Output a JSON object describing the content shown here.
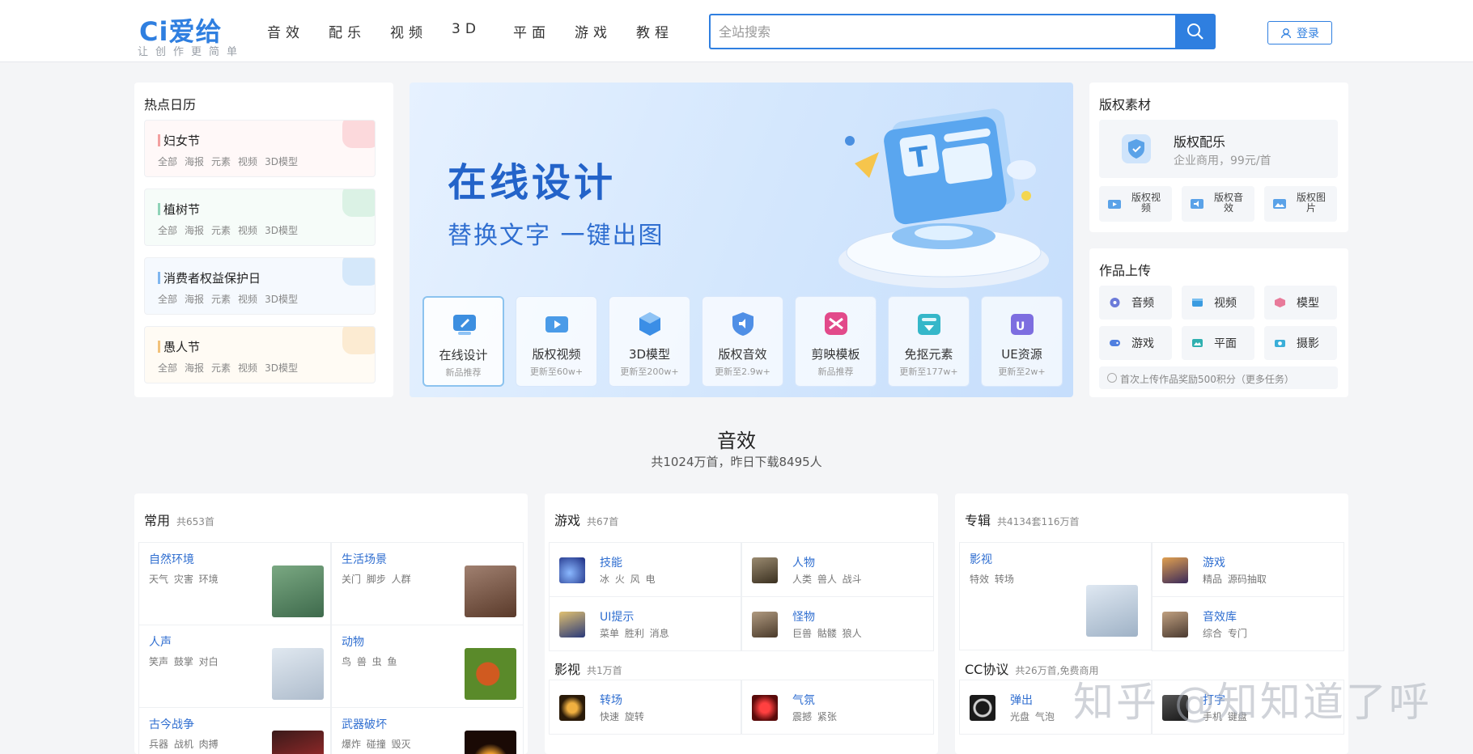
{
  "brand": {
    "logo": "Ci爱给",
    "slogan": "让创作更简单",
    "accent": "#2f7fe0"
  },
  "nav": [
    "音效",
    "配乐",
    "视频",
    "3D",
    "平面",
    "游戏",
    "教程"
  ],
  "search": {
    "placeholder": "全站搜索",
    "icon": "search-icon"
  },
  "login": {
    "label": "登录",
    "icon": "user-icon"
  },
  "hot_calendar": {
    "title": "热点日历",
    "items": [
      {
        "name": "妇女节",
        "color": "#f3a0a0",
        "tags": [
          "全部",
          "海报",
          "元素",
          "视频",
          "3D模型"
        ]
      },
      {
        "name": "植树节",
        "color": "#8fd3b8",
        "tags": [
          "全部",
          "海报",
          "元素",
          "视频",
          "3D模型"
        ]
      },
      {
        "name": "消费者权益保护日",
        "color": "#7fb6ef",
        "tags": [
          "全部",
          "海报",
          "元素",
          "视频",
          "3D模型"
        ]
      },
      {
        "name": "愚人节",
        "color": "#f2c27a",
        "tags": [
          "全部",
          "海报",
          "元素",
          "视频",
          "3D模型"
        ]
      }
    ]
  },
  "banner": {
    "title": "在线设计",
    "subtitle": "替换文字 一键出图",
    "tiles": [
      {
        "name": "在线设计",
        "sub": "新品推荐",
        "color": "#3d8fe0"
      },
      {
        "name": "版权视频",
        "sub": "更新至60w+",
        "color": "#4a9be8"
      },
      {
        "name": "3D模型",
        "sub": "更新至200w+",
        "color": "#3b8ee6"
      },
      {
        "name": "版权音效",
        "sub": "更新至2.9w+",
        "color": "#4f8fe6"
      },
      {
        "name": "剪映模板",
        "sub": "新品推荐",
        "color": "#e24a8a"
      },
      {
        "name": "免抠元素",
        "sub": "更新至177w+",
        "color": "#35b7c9"
      },
      {
        "name": "UE资源",
        "sub": "更新至2w+",
        "color": "#7d6ee0"
      }
    ]
  },
  "rights": {
    "title": "版权素材",
    "main": {
      "title": "版权配乐",
      "sub": "企业商用，99元/首"
    },
    "minis": [
      {
        "label": "版权视频",
        "color": "#5aa2e8"
      },
      {
        "label": "版权音效",
        "color": "#5aa2e8"
      },
      {
        "label": "版权图片",
        "color": "#5aa2e8"
      }
    ]
  },
  "upload": {
    "title": "作品上传",
    "buttons": [
      {
        "label": "音频",
        "color": "#6c7bd9"
      },
      {
        "label": "视频",
        "color": "#3a9be0"
      },
      {
        "label": "模型",
        "color": "#e87a9a"
      },
      {
        "label": "游戏",
        "color": "#4f7fe0"
      },
      {
        "label": "平面",
        "color": "#2fb0b0"
      },
      {
        "label": "摄影",
        "color": "#3aaed8"
      }
    ],
    "note": "首次上传作品奖励500积分（更多任务）"
  },
  "section": {
    "title": "音效",
    "sub": "共1024万首，昨日下载8495人"
  },
  "common": {
    "title": "常用",
    "count": "共653首",
    "cells": [
      {
        "title": "自然环境",
        "sub": "天气 灾害 环境",
        "img": "#4f7a5a"
      },
      {
        "title": "生活场景",
        "sub": "关门 脚步 人群",
        "img": "#7a5a4a"
      },
      {
        "title": "人声",
        "sub": "笑声 鼓掌 对白",
        "img": "#c9d6e3"
      },
      {
        "title": "动物",
        "sub": "鸟 兽 虫 鱼",
        "img": "#6a9a3a"
      },
      {
        "title": "古今战争",
        "sub": "兵器 战机 肉搏",
        "img": "#2a1a1a"
      },
      {
        "title": "武器破坏",
        "sub": "爆炸 碰撞 毁灭",
        "img": "#3a2010"
      }
    ]
  },
  "game": {
    "title": "游戏",
    "count": "共67首",
    "cells": [
      {
        "title": "技能",
        "sub": "冰 火 风 电",
        "img": "#2a3fa0"
      },
      {
        "title": "人物",
        "sub": "人类 兽人 战斗",
        "img": "#5a5040"
      },
      {
        "title": "UI提示",
        "sub": "菜单 胜利 消息",
        "img": "#3a4a8a"
      },
      {
        "title": "怪物",
        "sub": "巨兽 骷髅 狼人",
        "img": "#6a5a4a"
      }
    ],
    "film_title": "影视",
    "film_count": "共1万首",
    "film_cells": [
      {
        "title": "转场",
        "sub": "快速 旋转",
        "img": "#3a2a10"
      },
      {
        "title": "气氛",
        "sub": "震撼 紧张",
        "img": "#8a1a1a"
      }
    ]
  },
  "album": {
    "title": "专辑",
    "count": "共4134套116万首",
    "cells": [
      {
        "title": "影视",
        "sub": "特效 转场",
        "img": "#b7c6d6"
      },
      {
        "title": "游戏",
        "sub": "精品 源码抽取",
        "img": "#6a4a7a"
      },
      {
        "title": "音效库",
        "sub": "综合 专门",
        "img": "#7a6a5a"
      }
    ],
    "cc_title": "CC协议",
    "cc_count": "共26万首,免费商用",
    "cc_cells": [
      {
        "title": "弹出",
        "sub": "光盘 气泡",
        "img": "#1a1a1a"
      },
      {
        "title": "打字",
        "sub": "手机 键盘",
        "img": "#2a2a2a"
      }
    ]
  },
  "watermark": "知乎 @知知道了呼"
}
